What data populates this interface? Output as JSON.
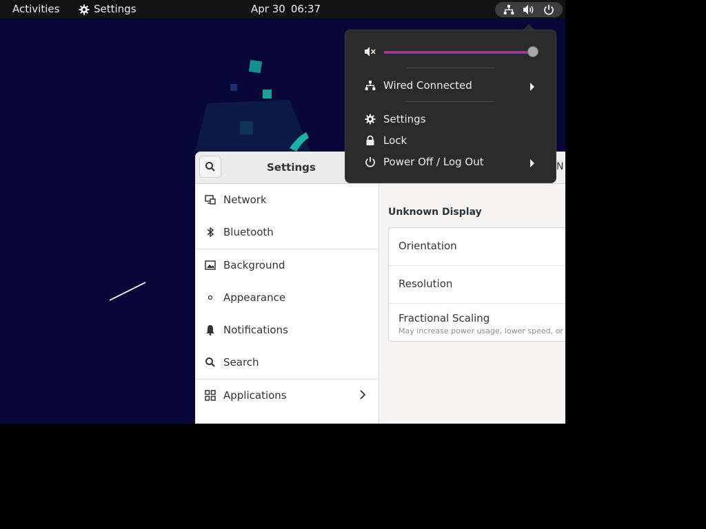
{
  "topbar": {
    "activities": "Activities",
    "app_name": "Settings",
    "date": "Apr 30",
    "time": "06:37"
  },
  "menu": {
    "volume_level": 1.0,
    "network_label": "Wired Connected",
    "settings_label": "Settings",
    "lock_label": "Lock",
    "power_label": "Power Off / Log Out"
  },
  "settings_window": {
    "title": "Settings",
    "sidebar": [
      {
        "label": "Network",
        "icon": "network-icon"
      },
      {
        "label": "Bluetooth",
        "icon": "bluetooth-icon"
      },
      {
        "label": "Background",
        "icon": "background-icon"
      },
      {
        "label": "Appearance",
        "icon": "appearance-icon"
      },
      {
        "label": "Notifications",
        "icon": "bell-icon"
      },
      {
        "label": "Search",
        "icon": "search-icon"
      },
      {
        "label": "Applications",
        "icon": "applications-icon"
      }
    ],
    "display_title": "Unknown Display",
    "rows": {
      "orientation": "Orientation",
      "resolution": "Resolution",
      "fractional_scaling": "Fractional Scaling",
      "fractional_scaling_sub": "May increase power usage, lower speed, or r"
    },
    "peek_text": "N"
  },
  "colors": {
    "accent": "#9c3b93",
    "topbar_bg": "#121212",
    "menu_bg": "#2b2b2b",
    "desktop_bg": "#070838",
    "wallpaper_teal": "#1bb3a3"
  }
}
